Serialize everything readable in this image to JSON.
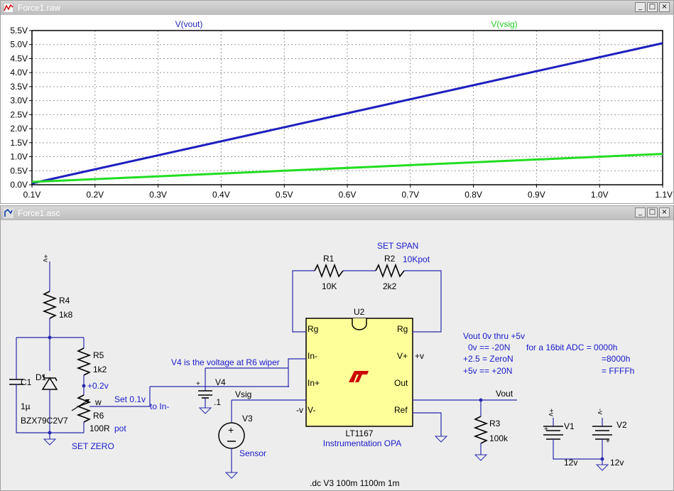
{
  "plot_window": {
    "title": "Force1.raw",
    "buttons": [
      "_",
      "□",
      "×"
    ]
  },
  "schematic_window": {
    "title": "Force1.asc",
    "buttons": [
      "_",
      "□",
      "×"
    ]
  },
  "chart_data": {
    "type": "line",
    "x_ticks": [
      "0.1V",
      "0.2V",
      "0.3V",
      "0.4V",
      "0.5V",
      "0.6V",
      "0.7V",
      "0.8V",
      "0.9V",
      "1.0V",
      "1.1V"
    ],
    "y_ticks": [
      "0.0V",
      "0.5V",
      "1.0V",
      "1.5V",
      "2.0V",
      "2.5V",
      "3.0V",
      "3.5V",
      "4.0V",
      "4.5V",
      "5.0V",
      "5.5V"
    ],
    "xlim": [
      0.1,
      1.1
    ],
    "ylim": [
      0.0,
      5.5
    ],
    "grid": true,
    "series": [
      {
        "name": "V(vout)",
        "color": "#1f1fbf",
        "x": [
          0.1,
          1.1
        ],
        "y": [
          0.05,
          5.05
        ]
      },
      {
        "name": "V(vsig)",
        "color": "#22dd22",
        "x": [
          0.1,
          1.1
        ],
        "y": [
          0.1,
          1.1
        ]
      }
    ]
  },
  "schematic": {
    "labels": {
      "r1": "R1",
      "r1_val": "10K",
      "r2": "R2",
      "r2_val": "2k2",
      "set_span": "SET SPAN",
      "pot_10k": "10Kpot",
      "u2": "U2",
      "rg_left": "Rg",
      "rg_right": "Rg",
      "in_minus": "In-",
      "in_plus": "In+",
      "v_plus": "V+",
      "plus_v": "+v",
      "out_pin": "Out",
      "v_minus": "V-",
      "minus_v": "-v",
      "ref": "Ref",
      "lt1167": "LT1167",
      "instr_opa": "Instrumentation OPA",
      "r4": "R4",
      "r4_val": "1k8",
      "r5": "R5",
      "r5_val": "1k2",
      "r6": "R6",
      "r6_val": "100R",
      "pot": "pot",
      "w": "w",
      "plus_02v": "+0.2v",
      "set_01v": "Set 0.1v",
      "to_in": "to In-",
      "c1": "C1",
      "c1_val": "1µ",
      "d1": "D1",
      "d1_val": "BZX79C2V7",
      "set_zero": "SET ZERO",
      "v4": "V4",
      "v4_val": ".1",
      "v4_note": "V4 is the voltage at R6 wiper",
      "vsig": "Vsig",
      "v3": "V3",
      "sensor": "Sensor",
      "vout": "Vout",
      "r3": "R3",
      "r3_val": "100k",
      "v1": "V1",
      "v1_val": "12v",
      "v2": "V2",
      "v2_val": "12v",
      "top_plusv": "+v",
      "top_minusv": "-v",
      "dc_cmd": ".dc V3 100m 1100m 1m",
      "note1": "Vout 0v thru +5v",
      "note2": "0v == -20N",
      "note3": "for a 16bit ADC = 0000h",
      "note4": "+2.5 = ZeroN",
      "note5": "=8000h",
      "note6": "+5v == +20N",
      "note7": "= FFFFh"
    }
  }
}
